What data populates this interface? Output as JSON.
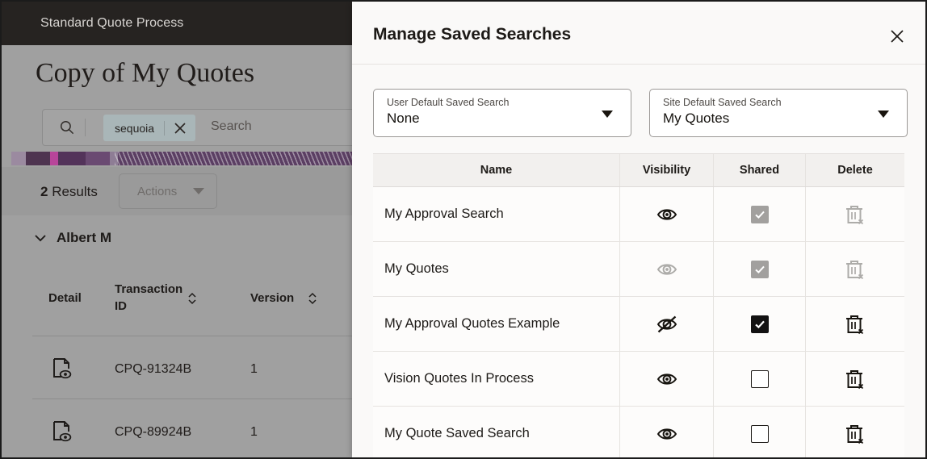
{
  "background": {
    "topbar_title": "Standard Quote Process",
    "page_heading": "Copy of My Quotes",
    "search": {
      "chip_label": "sequoia",
      "placeholder": "Search"
    },
    "results_count": "2",
    "results_label": "Results",
    "actions_label": "Actions",
    "group_name": "Albert M",
    "table": {
      "columns": [
        "Detail",
        "Transaction ID",
        "Version"
      ],
      "rows": [
        {
          "transaction_id": "CPQ-91324B",
          "version": "1"
        },
        {
          "transaction_id": "CPQ-89924B",
          "version": "1"
        }
      ]
    }
  },
  "dialog": {
    "title": "Manage Saved Searches",
    "close_label": "Close",
    "selects": [
      {
        "label": "User Default Saved Search",
        "value": "None"
      },
      {
        "label": "Site Default Saved Search",
        "value": "My Quotes"
      }
    ],
    "table": {
      "columns": [
        "Name",
        "Visibility",
        "Shared",
        "Delete"
      ],
      "rows": [
        {
          "name": "My Approval Search",
          "visibility": "visible",
          "visibility_enabled": true,
          "shared": "checked-disabled",
          "delete_enabled": false
        },
        {
          "name": "My Quotes",
          "visibility": "visible",
          "visibility_enabled": false,
          "shared": "checked-disabled",
          "delete_enabled": false
        },
        {
          "name": "My Approval Quotes Example",
          "visibility": "hidden",
          "visibility_enabled": true,
          "shared": "checked",
          "delete_enabled": true
        },
        {
          "name": "Vision Quotes In Process",
          "visibility": "visible",
          "visibility_enabled": true,
          "shared": "unchecked",
          "delete_enabled": true
        },
        {
          "name": "My Quote Saved Search",
          "visibility": "visible",
          "visibility_enabled": true,
          "shared": "unchecked",
          "delete_enabled": true
        }
      ]
    }
  },
  "colors": {
    "topbar": "#262321",
    "overlay": "#a0a0a0",
    "dialog_bg": "#faf9f8",
    "accent_chip": "#a9b6b8",
    "banner": "#5b3f63"
  }
}
